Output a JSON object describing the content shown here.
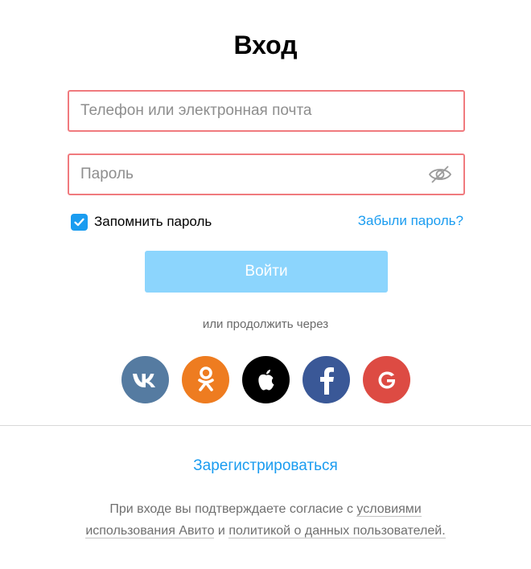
{
  "page": {
    "title": "Вход"
  },
  "form": {
    "phone": {
      "placeholder": "Телефон или электронная почта",
      "value": ""
    },
    "password": {
      "placeholder": "Пароль",
      "value": "",
      "toggle_icon": "eye-crossed-icon"
    },
    "remember": {
      "label": "Запомнить пароль",
      "checked": true
    },
    "forgot_label": "Забыли пароль?",
    "submit_label": "Войти",
    "invalid_border_color": "#f07a7e"
  },
  "social": {
    "caption": "или продолжить через",
    "providers": [
      {
        "name": "vk",
        "icon": "vk-icon",
        "color": "#557ba1"
      },
      {
        "name": "odnoklassniki",
        "icon": "odnoklassniki-icon",
        "color": "#ee7c20"
      },
      {
        "name": "apple",
        "icon": "apple-icon",
        "color": "#000000"
      },
      {
        "name": "facebook",
        "icon": "facebook-icon",
        "color": "#3a5897"
      },
      {
        "name": "google",
        "icon": "google-icon",
        "color": "#dd4b43"
      }
    ]
  },
  "footer": {
    "register_label": "Зарегистрироваться",
    "legal_prefix": "При входе вы подтверждаете согласие с",
    "terms_link": "условиями использования Авито",
    "legal_and": "и",
    "privacy_link": "политикой о данных пользователей."
  },
  "colors": {
    "accent": "#1a9cf0",
    "button_disabled": "#8cd5fd"
  }
}
